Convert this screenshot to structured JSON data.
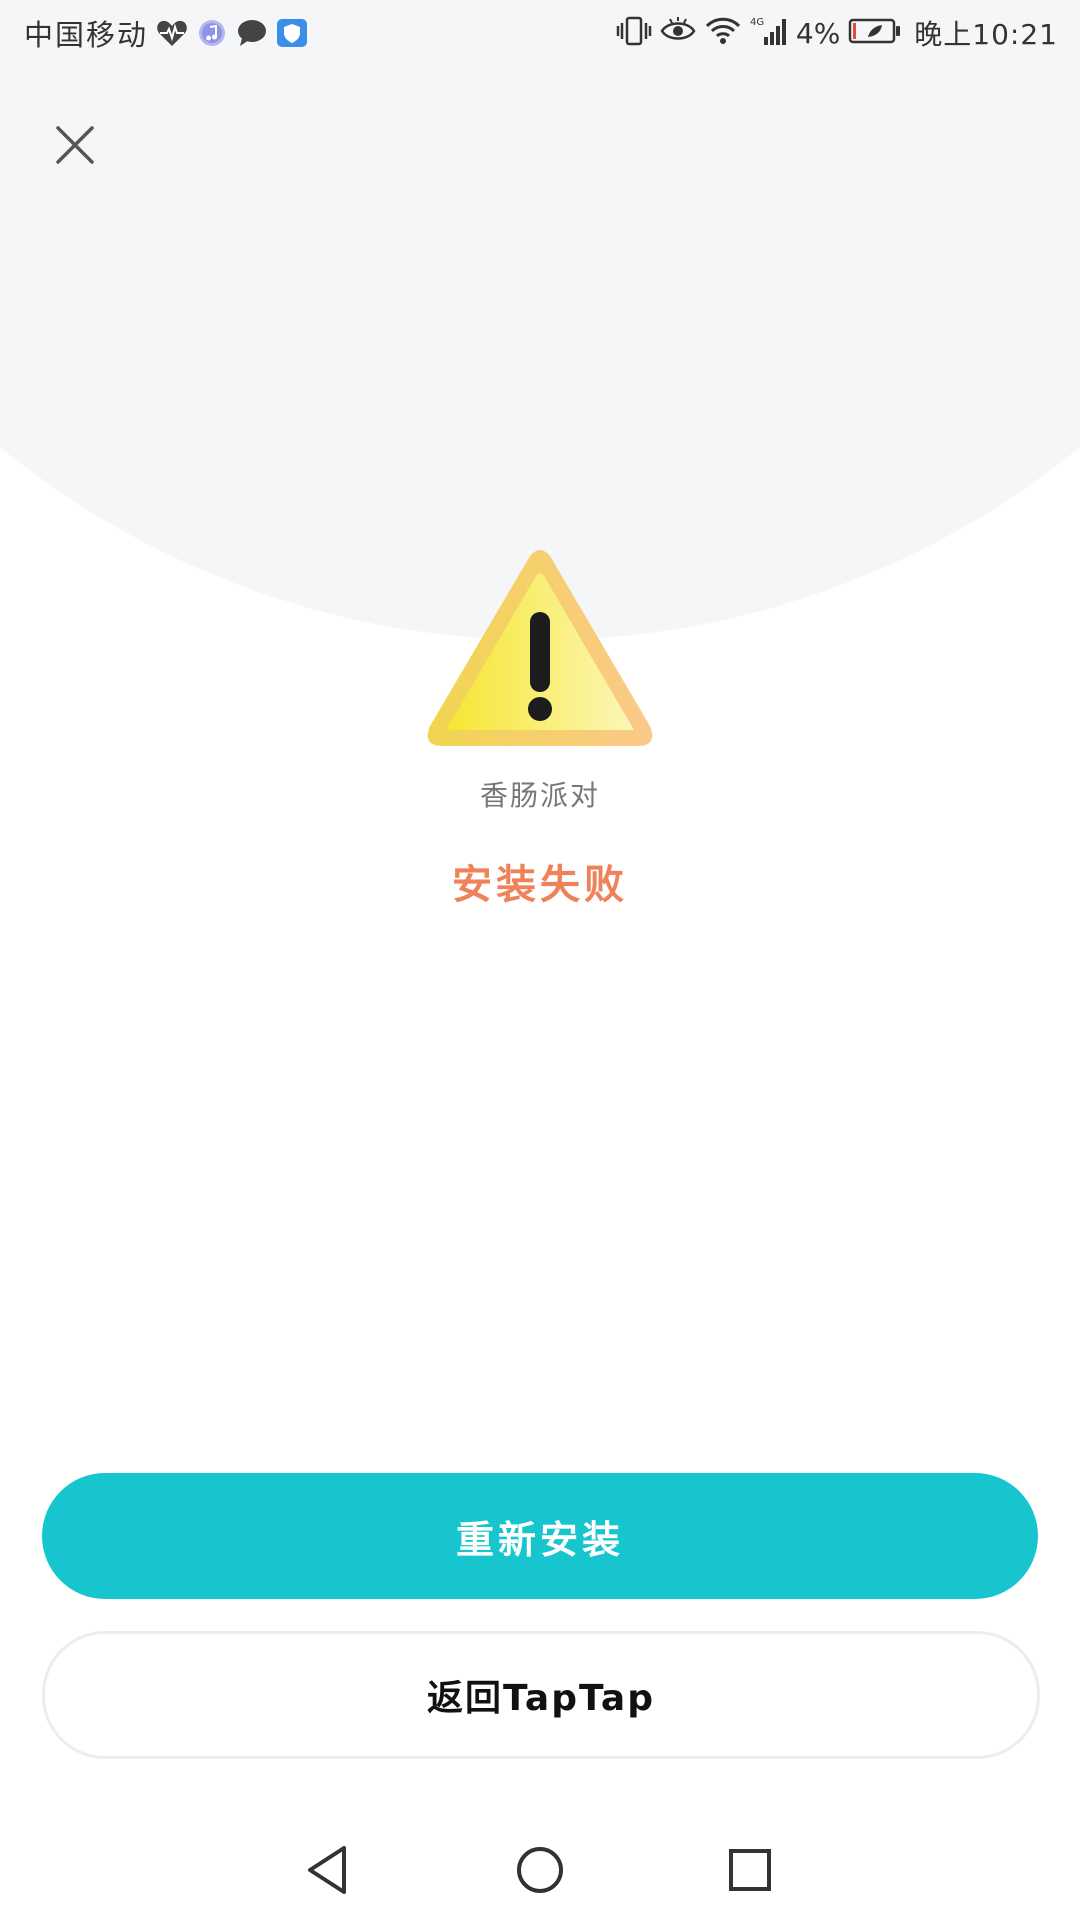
{
  "status_bar": {
    "carrier": "中国移动",
    "network": "4G",
    "battery": "4%",
    "time": "晚上10:21",
    "left_icons": [
      "heart-rate-icon",
      "music-icon",
      "message-icon",
      "shield-icon"
    ],
    "right_icons": [
      "vibrate-icon",
      "eye-icon",
      "wifi-icon",
      "signal-icon",
      "battery-icon"
    ]
  },
  "header": {
    "close_icon": "close-icon"
  },
  "main": {
    "warning_icon": "warning-icon",
    "app_name": "香肠派对",
    "status_text": "安装失败"
  },
  "actions": {
    "reinstall_label": "重新安装",
    "back_label": "返回TapTap"
  },
  "nav_bar": {
    "icons": [
      "back-icon",
      "home-icon",
      "recent-apps-icon"
    ]
  },
  "colors": {
    "accent": "#16c5cd",
    "error_text": "#f0825a",
    "warning_yellow": "#f7e64a",
    "warning_orange": "#f9c77a"
  }
}
